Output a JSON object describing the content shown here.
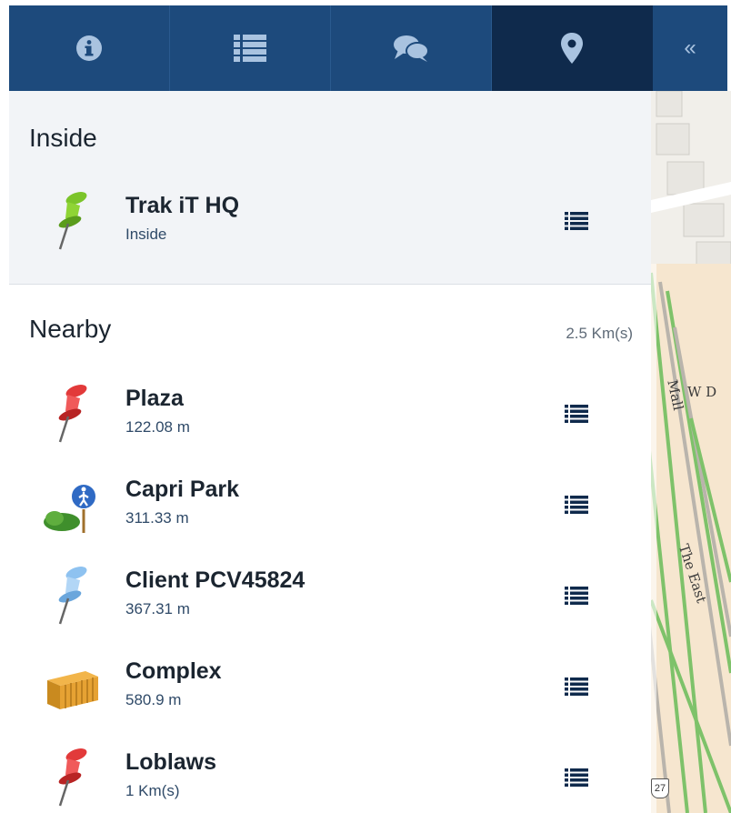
{
  "tabs": [
    {
      "id": "info",
      "icon": "info-circle-icon"
    },
    {
      "id": "list",
      "icon": "list-icon"
    },
    {
      "id": "comments",
      "icon": "comments-icon"
    },
    {
      "id": "location",
      "icon": "map-marker-icon",
      "active": true
    }
  ],
  "collapse": {
    "icon": "double-chevron-left-icon",
    "glyph": "«"
  },
  "inside": {
    "title": "Inside",
    "items": [
      {
        "name": "Trak iT HQ",
        "sub": "Inside",
        "icon": "green-pushpin-icon"
      }
    ]
  },
  "nearby": {
    "title": "Nearby",
    "range": "2.5 Km(s)",
    "items": [
      {
        "name": "Plaza",
        "sub": "122.08 m",
        "icon": "red-pushpin-icon"
      },
      {
        "name": "Capri Park",
        "sub": "311.33 m",
        "icon": "park-sign-icon"
      },
      {
        "name": "Client PCV45824",
        "sub": "367.31 m",
        "icon": "blue-pushpin-icon"
      },
      {
        "name": "Complex",
        "sub": "580.9 m",
        "icon": "shipping-container-icon"
      },
      {
        "name": "Loblaws",
        "sub": "1 Km(s)",
        "icon": "red-pushpin-icon"
      }
    ]
  },
  "map": {
    "labels": {
      "mall": "Mall",
      "wd": "W D",
      "east": "The East",
      "shield": "27"
    }
  },
  "colors": {
    "tabbar": "#1d4a7c",
    "tab_active": "#0f2a4c",
    "icon_light": "#a9c3e0",
    "subtext": "#2f4a68"
  }
}
